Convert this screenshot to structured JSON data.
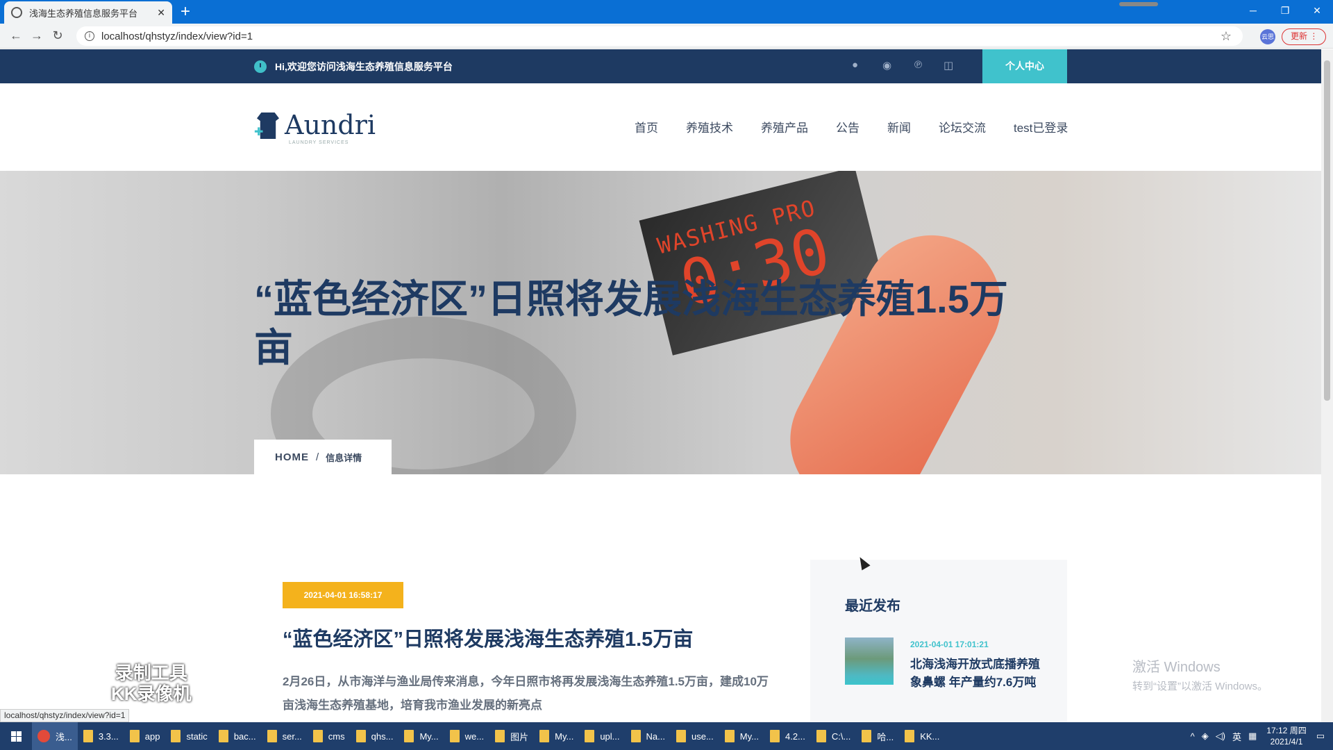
{
  "browser": {
    "tab_title": "浅海生态养殖信息服务平台",
    "tab_close": "✕",
    "new_tab": "+",
    "url": "localhost/qhstyz/index/view?id=1",
    "profile_label": "云思",
    "update_label": "更新",
    "window_controls": [
      "─",
      "❐",
      "✕"
    ],
    "status_url": "localhost/qhstyz/index/view?id=1"
  },
  "topbar": {
    "welcome": "Hi,欢迎您访问浅海生态养殖信息服务平台",
    "social_icons": [
      "qq-icon",
      "wechat-icon",
      "pinterest-icon",
      "instagram-icon"
    ],
    "personal_center": "个人中心"
  },
  "header": {
    "logo_text": "Aundri",
    "logo_sub": "LAUNDRY SERVICES",
    "nav": [
      "首页",
      "养殖技术",
      "养殖产品",
      "公告",
      "新闻",
      "论坛交流",
      "test已登录"
    ]
  },
  "hero": {
    "panel_line1": "WASHING PRO",
    "panel_line2": "0:30",
    "title": "“蓝色经济区”日照将发展浅海生态养殖1.5万亩"
  },
  "breadcrumb": {
    "home": "HOME",
    "separator": "/",
    "current": "信息详情"
  },
  "article": {
    "date": "2021-04-01 16:58:17",
    "title": "“蓝色经济区”日照将发展浅海生态养殖1.5万亩",
    "body": "2月26日，从市海洋与渔业局传来消息，今年日照市将再发展浅海生态养殖1.5万亩，建成10万亩浅海生态养殖基地，培育我市渔业发展的新亮点"
  },
  "sidebar": {
    "heading": "最近发布",
    "posts": [
      {
        "date": "2021-04-01 17:01:21",
        "title": "北海浅海开放式底播养殖象鼻螺 年产量约7.6万吨"
      }
    ]
  },
  "overlay": {
    "recorder_watermark_l1": "录制工具",
    "recorder_watermark_l2": "KK录像机",
    "activate_l1": "激活 Windows",
    "activate_l2": "转到“设置”以激活 Windows。"
  },
  "taskbar": {
    "items": [
      "浅...",
      "3.3...",
      "app",
      "static",
      "bac...",
      "ser...",
      "cms",
      "qhs...",
      "My...",
      "we...",
      "图片",
      "My...",
      "upl...",
      "Na...",
      "use...",
      "My...",
      "4.2...",
      "C:\\...",
      "哈...",
      "KK..."
    ],
    "ime": "英",
    "time": "17:12 周四",
    "date": "2021/4/1"
  },
  "colors": {
    "navy": "#1e3a62",
    "teal": "#40c2cc",
    "badge": "#f4b21c",
    "chrome_blue": "#0a6fd4"
  }
}
